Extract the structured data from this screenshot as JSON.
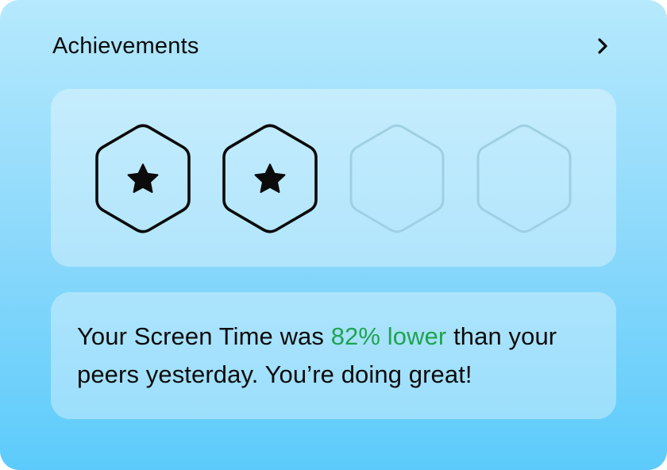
{
  "header": {
    "title": "Achievements",
    "chevron_icon": "chevron-right-icon"
  },
  "badges": [
    {
      "earned": true,
      "icon": "star-icon"
    },
    {
      "earned": true,
      "icon": "star-icon"
    },
    {
      "earned": false,
      "icon": "hexagon-icon"
    },
    {
      "earned": false,
      "icon": "hexagon-icon"
    }
  ],
  "message": {
    "before": "Your Screen Time was ",
    "highlight": "82% lower",
    "after": " than your peers yesterday. You’re doing great!"
  },
  "colors": {
    "highlight": "#1fa350",
    "earned_stroke": "#0b0b0b",
    "locked_stroke": "#9fcfe2"
  }
}
